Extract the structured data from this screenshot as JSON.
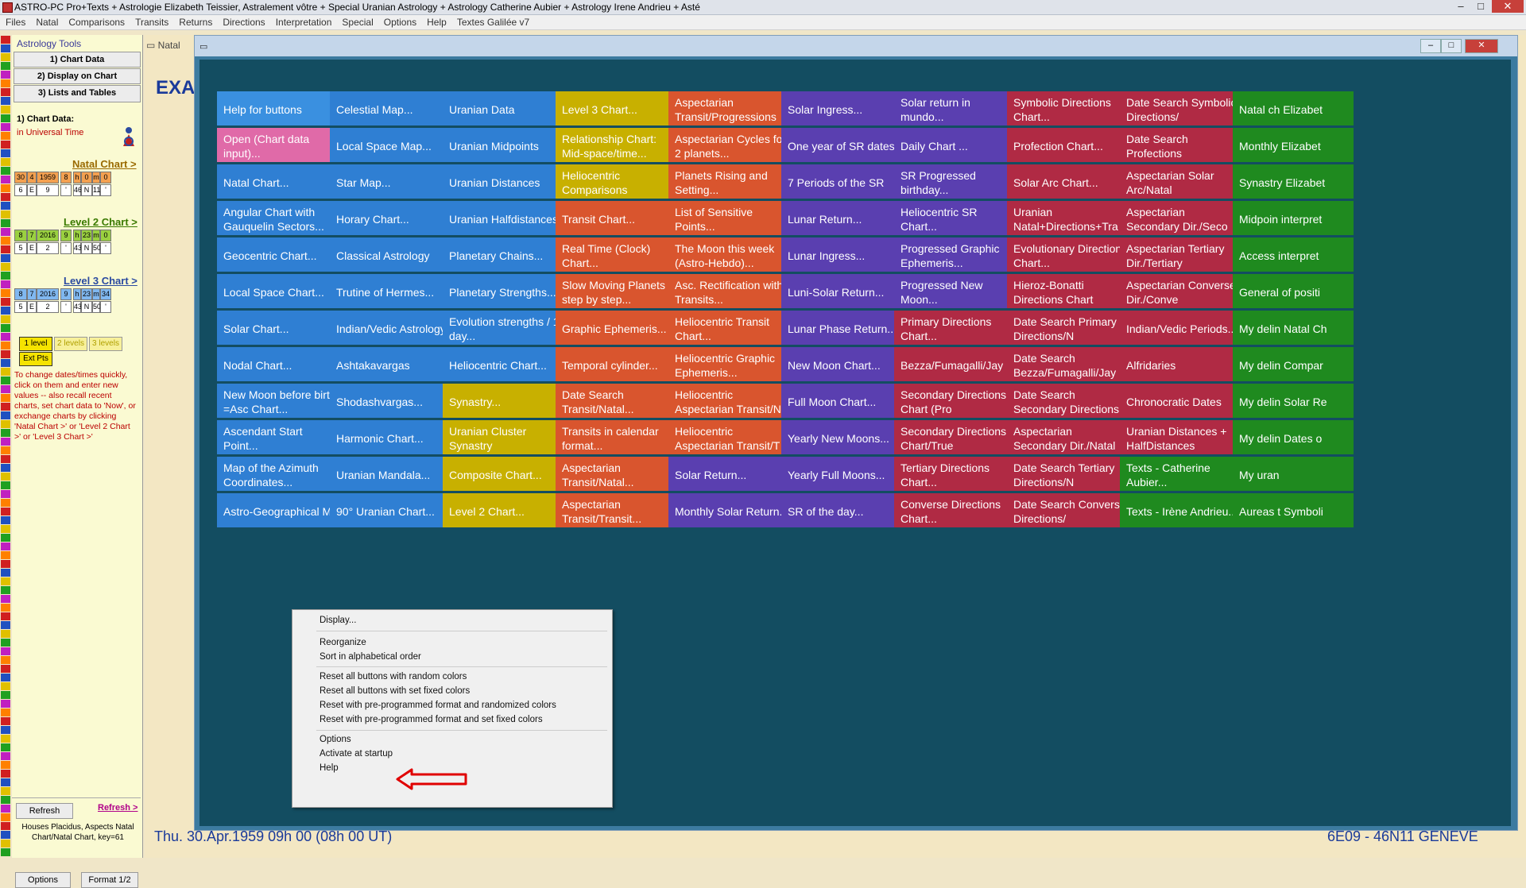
{
  "window": {
    "title": "ASTRO-PC Pro+Texts + Astrologie Elizabeth Teissier, Astralement vôtre + Special Uranian Astrology + Astrology Catherine Aubier + Astrology Irene Andrieu + Asté",
    "min": "–",
    "max": "□",
    "close": "✕"
  },
  "menu": [
    "Files",
    "Natal",
    "Comparisons",
    "Transits",
    "Returns",
    "Directions",
    "Interpretation",
    "Special",
    "Options",
    "Help",
    "Textes Galilée v7"
  ],
  "left_panel": {
    "header": "Astrology Tools",
    "btn_chart_data": "1) Chart Data",
    "btn_display": "2) Display on Chart",
    "btn_lists": "3) Lists and Tables",
    "section_chart_data": "1) Chart Data:",
    "universal_time": "in Universal Time",
    "natal_chart_link": "Natal Chart >",
    "natal_row1": [
      "30",
      "4",
      "1959",
      "8",
      "h",
      "0",
      "m",
      "0"
    ],
    "natal_row2": [
      "6",
      "E",
      "9",
      "'",
      "46",
      "N",
      "11",
      "'"
    ],
    "level2_link": "Level 2 Chart >",
    "level2_row1": [
      "8",
      "7",
      "2016",
      "9",
      "h",
      "23",
      "m",
      "0"
    ],
    "level2_row2": [
      "5",
      "E",
      "2",
      "'",
      "43",
      "N",
      "50",
      "'"
    ],
    "level3_link": "Level 3 Chart >",
    "level3_row1": [
      "8",
      "7",
      "2016",
      "9",
      "h",
      "23",
      "m",
      "34"
    ],
    "level3_row2": [
      "5",
      "E",
      "2",
      "'",
      "43",
      "N",
      "50",
      "'"
    ],
    "btn_1level": "1 level",
    "btn_2levels": "2 levels",
    "btn_3levels": "3 levels",
    "btn_extpts": "Ext Pts",
    "note": "To change dates/times quickly, click on them and enter new values -- also recall recent charts, set chart data to 'Now', or exchange charts by clicking 'Natal Chart >' or 'Level 2 Chart >' or 'Level 3 Chart >'",
    "btn_refresh": "Refresh",
    "link_refresh": "Refresh >",
    "houses_info": "Houses Placidus, Aspects Natal Chart/Natal Chart, key=61",
    "btn_options": "Options",
    "btn_format": "Format 1/2"
  },
  "background_window": {
    "tab": "Natal",
    "heading": "EXA",
    "footer_left": "Thu. 30.Apr.1959 09h 00 (08h 00 UT)",
    "footer_right": "6E09 - 46N11  GENEVE"
  },
  "tool_window": {
    "title_icon": "▭",
    "columns": [
      {
        "color": "#2f7fd3",
        "buttons": [
          {
            "label": "Help for buttons",
            "color": "#3a90e0"
          },
          {
            "label": "Open (Chart data input)...",
            "color": "#e06aa8"
          },
          {
            "label": "Natal Chart..."
          },
          {
            "label": "Angular Chart with Gauquelin Sectors..."
          },
          {
            "label": "Geocentric Chart..."
          },
          {
            "label": "Local Space Chart..."
          },
          {
            "label": "Solar Chart..."
          },
          {
            "label": "Nodal Chart..."
          },
          {
            "label": "New Moon before birth =Asc Chart..."
          },
          {
            "label": "Ascendant Start Point..."
          },
          {
            "label": "Map of the Azimuth Coordinates..."
          },
          {
            "label": "Astro-Geographical M"
          }
        ]
      },
      {
        "color": "#2f7fd3",
        "buttons": [
          {
            "label": "Celestial Map..."
          },
          {
            "label": "Local Space Map..."
          },
          {
            "label": "Star Map..."
          },
          {
            "label": "Horary Chart..."
          },
          {
            "label": "Classical Astrology"
          },
          {
            "label": "Trutine of Hermes..."
          },
          {
            "label": "Indian/Vedic Astrology"
          },
          {
            "label": "Ashtakavargas"
          },
          {
            "label": "Shodashvargas..."
          },
          {
            "label": "Harmonic Chart..."
          },
          {
            "label": "Uranian Mandala..."
          },
          {
            "label": "90° Uranian Chart..."
          }
        ]
      },
      {
        "color": "#2f7fd3",
        "buttons": [
          {
            "label": "Uranian Data"
          },
          {
            "label": "Uranian Midpoints"
          },
          {
            "label": "Uranian Distances"
          },
          {
            "label": "Uranian Halfdistances"
          },
          {
            "label": "Planetary Chains..."
          },
          {
            "label": "Planetary Strengths..."
          },
          {
            "label": "Evolution strengths / 1 day..."
          },
          {
            "label": "Heliocentric Chart..."
          },
          {
            "label": "Synastry...",
            "color": "#c8b000"
          },
          {
            "label": "Uranian Cluster Synastry",
            "color": "#c8b000"
          },
          {
            "label": "Composite Chart...",
            "color": "#c8b000"
          },
          {
            "label": "Level 2 Chart...",
            "color": "#c8b000"
          }
        ]
      },
      {
        "color": "#d9552e",
        "buttons": [
          {
            "label": "Level 3 Chart...",
            "color": "#c8b000"
          },
          {
            "label": "Relationship Chart: Mid-space/time...",
            "color": "#c8b000"
          },
          {
            "label": "Heliocentric Comparisons",
            "color": "#c8b000"
          },
          {
            "label": "Transit Chart..."
          },
          {
            "label": "Real Time (Clock) Chart..."
          },
          {
            "label": "Slow Moving Planets step by step..."
          },
          {
            "label": "Graphic Ephemeris..."
          },
          {
            "label": "Temporal cylinder..."
          },
          {
            "label": "Date Search Transit/Natal..."
          },
          {
            "label": "Transits in calendar format..."
          },
          {
            "label": "Aspectarian Transit/Natal..."
          },
          {
            "label": "Aspectarian Transit/Transit..."
          }
        ]
      },
      {
        "color": "#d9552e",
        "buttons": [
          {
            "label": "Aspectarian Transit/Progressions"
          },
          {
            "label": "Aspectarian Cycles for 2 planets..."
          },
          {
            "label": "Planets Rising and Setting..."
          },
          {
            "label": "List of Sensitive Points..."
          },
          {
            "label": "The Moon this week (Astro-Hebdo)..."
          },
          {
            "label": "Asc. Rectification with Transits..."
          },
          {
            "label": "Heliocentric Transit Chart..."
          },
          {
            "label": "Heliocentric Graphic Ephemeris..."
          },
          {
            "label": "Heliocentric Aspectarian Transit/N"
          },
          {
            "label": "Heliocentric Aspectarian Transit/T"
          },
          {
            "label": "Solar Return...",
            "color": "#5a3fb0"
          },
          {
            "label": "Monthly Solar Return...",
            "color": "#5a3fb0"
          }
        ]
      },
      {
        "color": "#5a3fb0",
        "buttons": [
          {
            "label": "Solar Ingress..."
          },
          {
            "label": "One year of SR dates"
          },
          {
            "label": "7 Periods of the SR"
          },
          {
            "label": "Lunar Return..."
          },
          {
            "label": "Lunar Ingress..."
          },
          {
            "label": "Luni-Solar Return..."
          },
          {
            "label": "Lunar Phase Return..."
          },
          {
            "label": "New Moon Chart..."
          },
          {
            "label": "Full Moon Chart..."
          },
          {
            "label": "Yearly New Moons..."
          },
          {
            "label": "Yearly Full Moons..."
          },
          {
            "label": "SR of the day..."
          }
        ]
      },
      {
        "color": "#5a3fb0",
        "buttons": [
          {
            "label": "Solar return in mundo..."
          },
          {
            "label": "Daily Chart ..."
          },
          {
            "label": "SR Progressed birthday..."
          },
          {
            "label": "Heliocentric SR Chart..."
          },
          {
            "label": "Progressed Graphic Ephemeris..."
          },
          {
            "label": "Progressed New Moon..."
          },
          {
            "label": "Primary Directions Chart...",
            "color": "#b02a44"
          },
          {
            "label": "Bezza/Fumagalli/Jay",
            "color": "#b02a44"
          },
          {
            "label": "Secondary Directions Chart (Pro",
            "color": "#b02a44"
          },
          {
            "label": "Secondary Directions Chart/True",
            "color": "#b02a44"
          },
          {
            "label": "Tertiary Directions Chart...",
            "color": "#b02a44"
          },
          {
            "label": "Converse Directions Chart...",
            "color": "#b02a44"
          }
        ]
      },
      {
        "color": "#b02a44",
        "buttons": [
          {
            "label": "Symbolic Directions Chart..."
          },
          {
            "label": "Profection Chart..."
          },
          {
            "label": "Solar Arc Chart..."
          },
          {
            "label": "Uranian Natal+Directions+Tra"
          },
          {
            "label": "Evolutionary Directions Chart..."
          },
          {
            "label": "Hieroz-Bonatti Directions Chart"
          },
          {
            "label": "Date Search Primary Directions/N"
          },
          {
            "label": "Date Search Bezza/Fumagalli/Jay"
          },
          {
            "label": "Date Search Secondary Directions"
          },
          {
            "label": "Aspectarian Secondary Dir./Natal"
          },
          {
            "label": "Date Search Tertiary Directions/N"
          },
          {
            "label": "Date Search Converse Directions/"
          }
        ]
      },
      {
        "color": "#b02a44",
        "buttons": [
          {
            "label": "Date Search Symbolic Directions/"
          },
          {
            "label": "Date Search Profections"
          },
          {
            "label": "Aspectarian Solar Arc/Natal"
          },
          {
            "label": "Aspectarian Secondary Dir./Seco"
          },
          {
            "label": "Aspectarian Tertiary Dir./Tertiary"
          },
          {
            "label": "Aspectarian Converse Dir./Conve"
          },
          {
            "label": "Indian/Vedic Periods..."
          },
          {
            "label": "Alfridaries"
          },
          {
            "label": "Chronocratic Dates"
          },
          {
            "label": "Uranian Distances + HalfDistances"
          },
          {
            "label": "Texts - Catherine Aubier...",
            "color": "#1f8a1f"
          },
          {
            "label": "Texts - Irène Andrieu...",
            "color": "#1f8a1f"
          }
        ]
      },
      {
        "color": "#1f8a1f",
        "buttons": [
          {
            "label": "Natal ch Elizabet"
          },
          {
            "label": "Monthly Elizabet"
          },
          {
            "label": "Synastry Elizabet"
          },
          {
            "label": "Midpoin interpret"
          },
          {
            "label": "Access interpret"
          },
          {
            "label": "General of positi"
          },
          {
            "label": "My delin Natal Ch"
          },
          {
            "label": "My delin Compar"
          },
          {
            "label": "My delin Solar Re"
          },
          {
            "label": "My delin Dates o"
          },
          {
            "label": "My uran"
          },
          {
            "label": "Aureas t Symboli"
          }
        ]
      }
    ]
  },
  "context_menu": {
    "display": "Display...",
    "reorganize": "Reorganize",
    "sort": "Sort in alphabetical order",
    "reset_random": "Reset all buttons with random colors",
    "reset_fixed": "Reset all buttons with set fixed colors",
    "reset_preprog_random": "Reset with pre-programmed format and randomized colors",
    "reset_preprog_fixed": "Reset with pre-programmed format and set fixed colors",
    "options": "Options",
    "activate": "Activate at startup",
    "help": "Help"
  },
  "colors": {
    "arrow": "#e00000",
    "grid_bg": "#134d61"
  }
}
